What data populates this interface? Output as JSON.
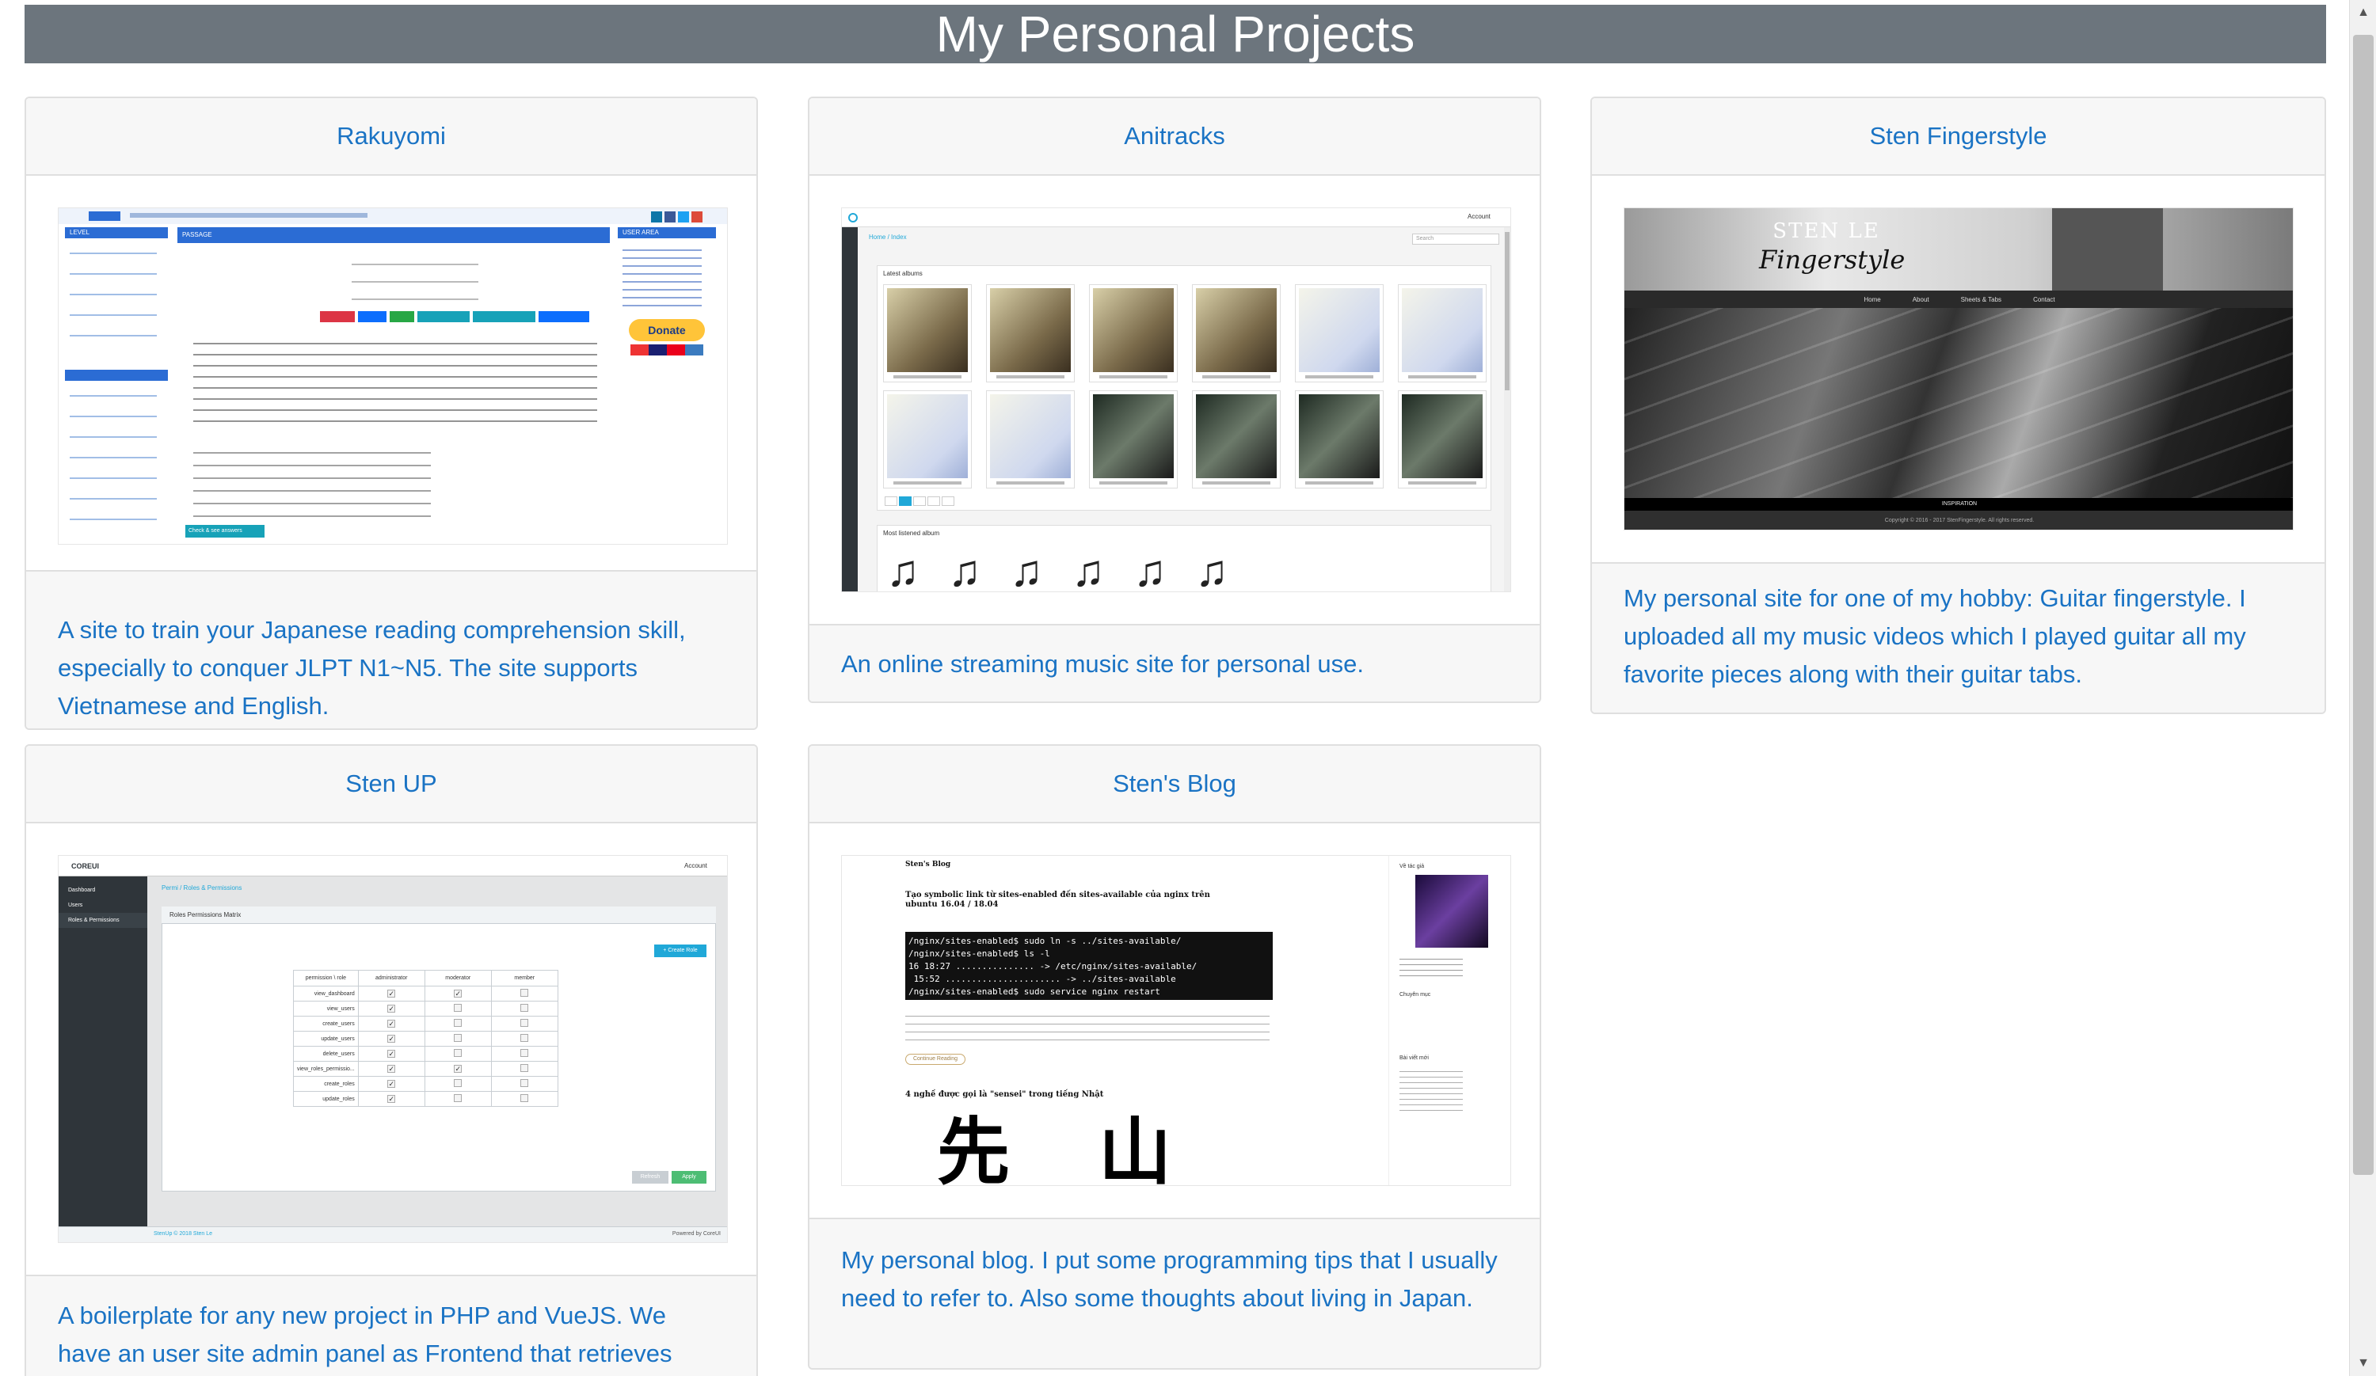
{
  "header": {
    "title": "My Personal Projects"
  },
  "projects": [
    {
      "title": "Rakuyomi",
      "description": "A site to train your Japanese reading comprehension skill, especially to conquer JLPT N1~N5. The site supports Vietnamese and English."
    },
    {
      "title": "Anitracks",
      "description": "An online streaming music site for personal use."
    },
    {
      "title": "Sten Fingerstyle",
      "description": "My personal site for one of my hobby: Guitar fingerstyle. I uploaded all my music videos which I played guitar all my favorite pieces along with their guitar tabs."
    },
    {
      "title": "Sten UP",
      "description": "A boilerplate for any new project in PHP and VueJS. We have an user site admin panel as Frontend that retrieves"
    },
    {
      "title": "Sten's Blog",
      "description": "My personal blog. I put some programming tips that I usually need to refer to. Also some thoughts about living in Japan."
    }
  ],
  "screenshots": {
    "rakuyomi": {
      "donate": "Donate",
      "level_header": "LEVEL",
      "passage_header": "PASSAGE",
      "user_area": "USER AREA",
      "check_button": "Check & see answers"
    },
    "anitracks": {
      "account": "Account",
      "breadcrumb": "Home / Index",
      "search": "Search",
      "latest": "Latest albums",
      "most_listened": "Most listened album"
    },
    "fingerstyle": {
      "name": "STEN LE",
      "script": "Fingerstyle",
      "nav": [
        "Home",
        "About",
        "Sheets & Tabs",
        "Contact"
      ],
      "banner": "INSPIRATION",
      "copyright": "Copyright © 2016 - 2017 StenFingerstyle. All rights reserved."
    },
    "stenup": {
      "logo": "COREUI",
      "account": "Account",
      "sidebar": [
        "Dashboard",
        "Users",
        "Roles & Permissions"
      ],
      "panel_title": "Roles Permissions Matrix",
      "create_role": "+ Create Role",
      "columns": [
        "permission \\ role",
        "administrator",
        "moderator",
        "member"
      ],
      "rows": [
        "view_dashboard",
        "view_users",
        "create_users",
        "update_users",
        "delete_users",
        "view_roles_permissio...",
        "create_roles",
        "update_roles"
      ],
      "footer_left": "StenUp © 2018 Sten Le",
      "footer_right": "Powered by CoreUI",
      "refresh": "Refresh",
      "apply": "Apply"
    },
    "blog": {
      "site": "Sten's Blog",
      "post_title": "Tạo symbolic link từ sites-enabled đến sites-available của nginx trên ubuntu 16.04 / 18.04",
      "terminal": [
        "/nginx/sites-enabled$ sudo ln -s ../sites-available/",
        "/nginx/sites-enabled$ ls -l",
        "16 18:27 ............... -> /etc/nginx/sites-available/",
        " 15:52 ...................... -> ../sites-available",
        "/nginx/sites-enabled$ sudo service nginx restart"
      ],
      "continue": "Continue Reading",
      "post2_title": "4 nghề được gọi là \"sensei\" trong tiếng Nhật",
      "kanji": "先 山",
      "side_about": "Về tác giả",
      "side_topics": "Chuyên mục",
      "side_recent": "Bài viết mới"
    }
  }
}
